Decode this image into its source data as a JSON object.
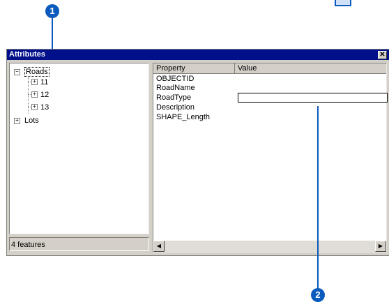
{
  "callouts": {
    "one": "1",
    "two": "2"
  },
  "window": {
    "title": "Attributes",
    "close_glyph": "✕"
  },
  "tree": {
    "root": {
      "label": "Roads",
      "expander": "−"
    },
    "children": [
      {
        "label": "11",
        "expander": "+"
      },
      {
        "label": "12",
        "expander": "+"
      },
      {
        "label": "13",
        "expander": "+"
      }
    ],
    "second_root": {
      "label": "Lots",
      "expander": "+"
    }
  },
  "status": {
    "text": "4 features"
  },
  "grid": {
    "headers": {
      "property": "Property",
      "value": "Value"
    },
    "properties": [
      "OBJECTID",
      "RoadName",
      "RoadType",
      "Description",
      "SHAPE_Length"
    ]
  },
  "scroll": {
    "left_glyph": "◀",
    "right_glyph": "▶"
  },
  "colors": {
    "accent": "#0a5bbd",
    "titlebar": "#000f8a",
    "window_bg": "#d4d0c8"
  }
}
